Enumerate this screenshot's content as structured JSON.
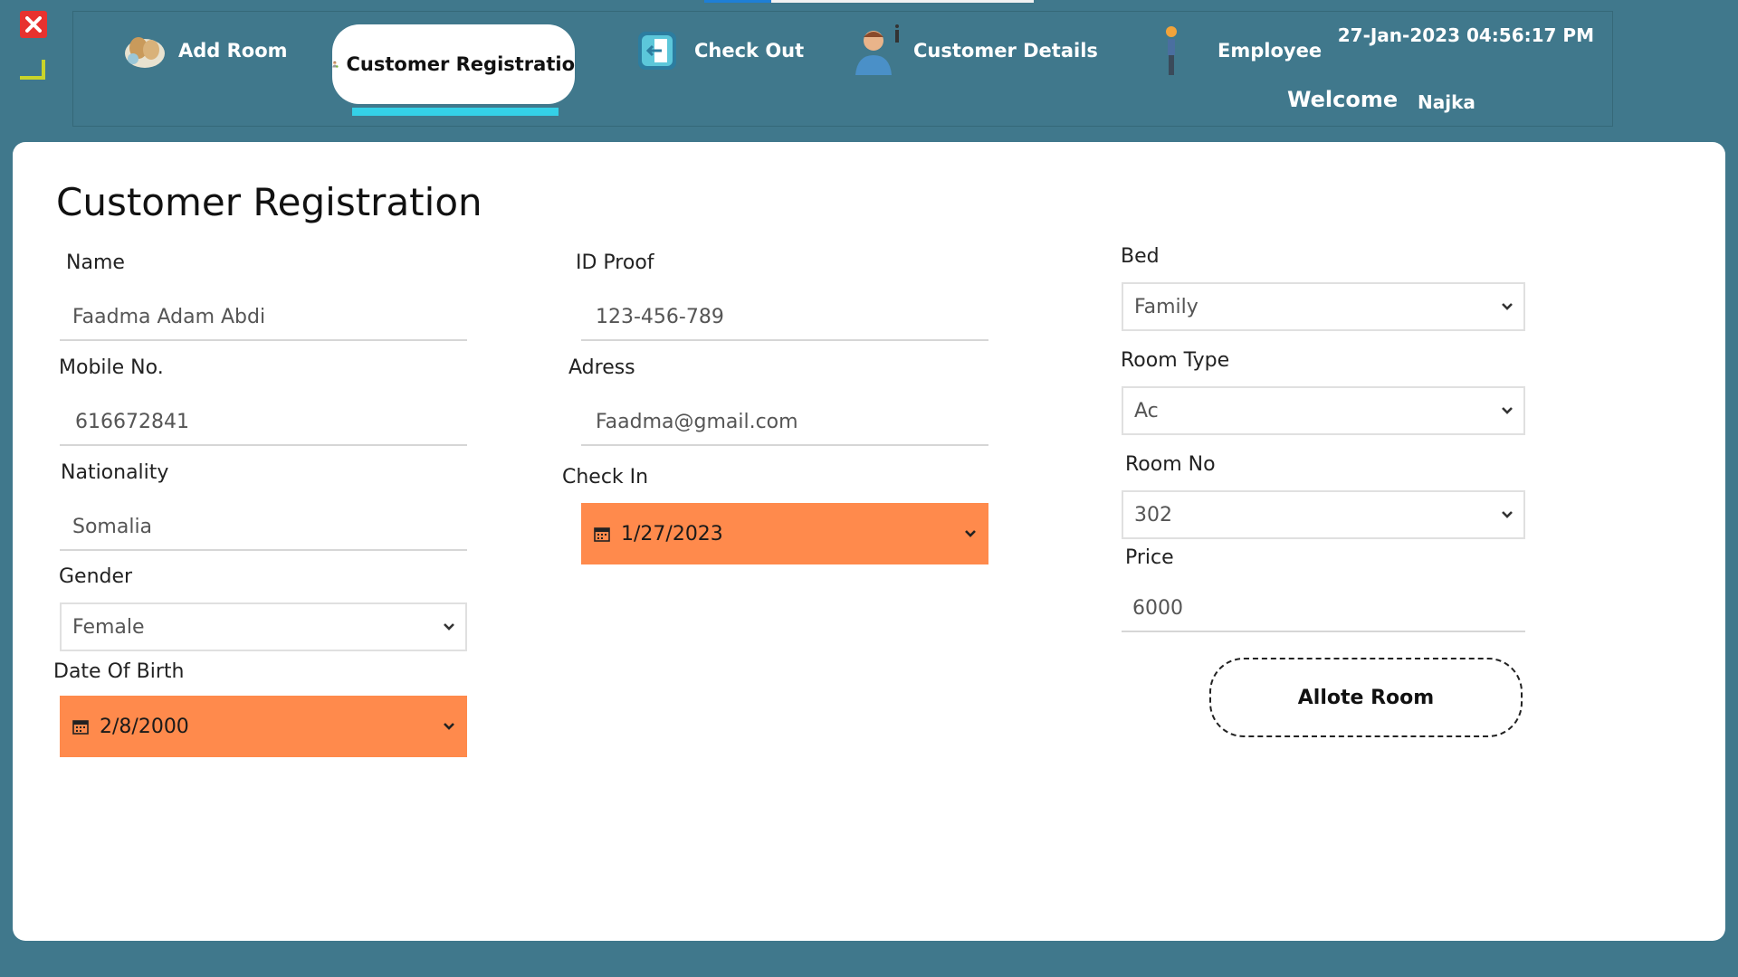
{
  "window": {
    "close_icon": "close-icon",
    "minimize_icon": "minimize-icon"
  },
  "nav": {
    "items": [
      {
        "label": "Add Room",
        "icon": "add-room-icon"
      },
      {
        "label": "Customer Registratio",
        "icon": "customer-registration-icon",
        "active": true
      },
      {
        "label": "Check Out",
        "icon": "check-out-icon"
      },
      {
        "label": "Customer Details",
        "icon": "customer-details-icon"
      },
      {
        "label": "Employee",
        "icon": "employee-icon"
      }
    ],
    "datetime": "27-Jan-2023 04:56:17 PM",
    "welcome_label": "Welcome",
    "username": "Najka"
  },
  "form": {
    "title": "Customer Registration",
    "name_label": "Name",
    "name_value": "Faadma Adam Abdi",
    "mobile_label": "Mobile No.",
    "mobile_value": "616672841",
    "nationality_label": "Nationality",
    "nationality_value": "Somalia",
    "gender_label": "Gender",
    "gender_value": "Female",
    "dob_label": "Date Of Birth",
    "dob_value": "2/8/2000",
    "idproof_label": "ID Proof",
    "idproof_value": "123-456-789",
    "address_label": "Adress",
    "address_value": "Faadma@gmail.com",
    "checkin_label": "Check In",
    "checkin_value": "1/27/2023",
    "bed_label": "Bed",
    "bed_value": "Family",
    "roomtype_label": "Room Type",
    "roomtype_value": "Ac",
    "roomno_label": "Room No",
    "roomno_value": "302",
    "price_label": "Price",
    "price_value": "6000",
    "submit_label": "Allote Room"
  },
  "colors": {
    "background": "#40788C",
    "accent_orange": "#FF8A4C",
    "nav_underline": "#34D1E8",
    "close_red": "#E8322F"
  }
}
